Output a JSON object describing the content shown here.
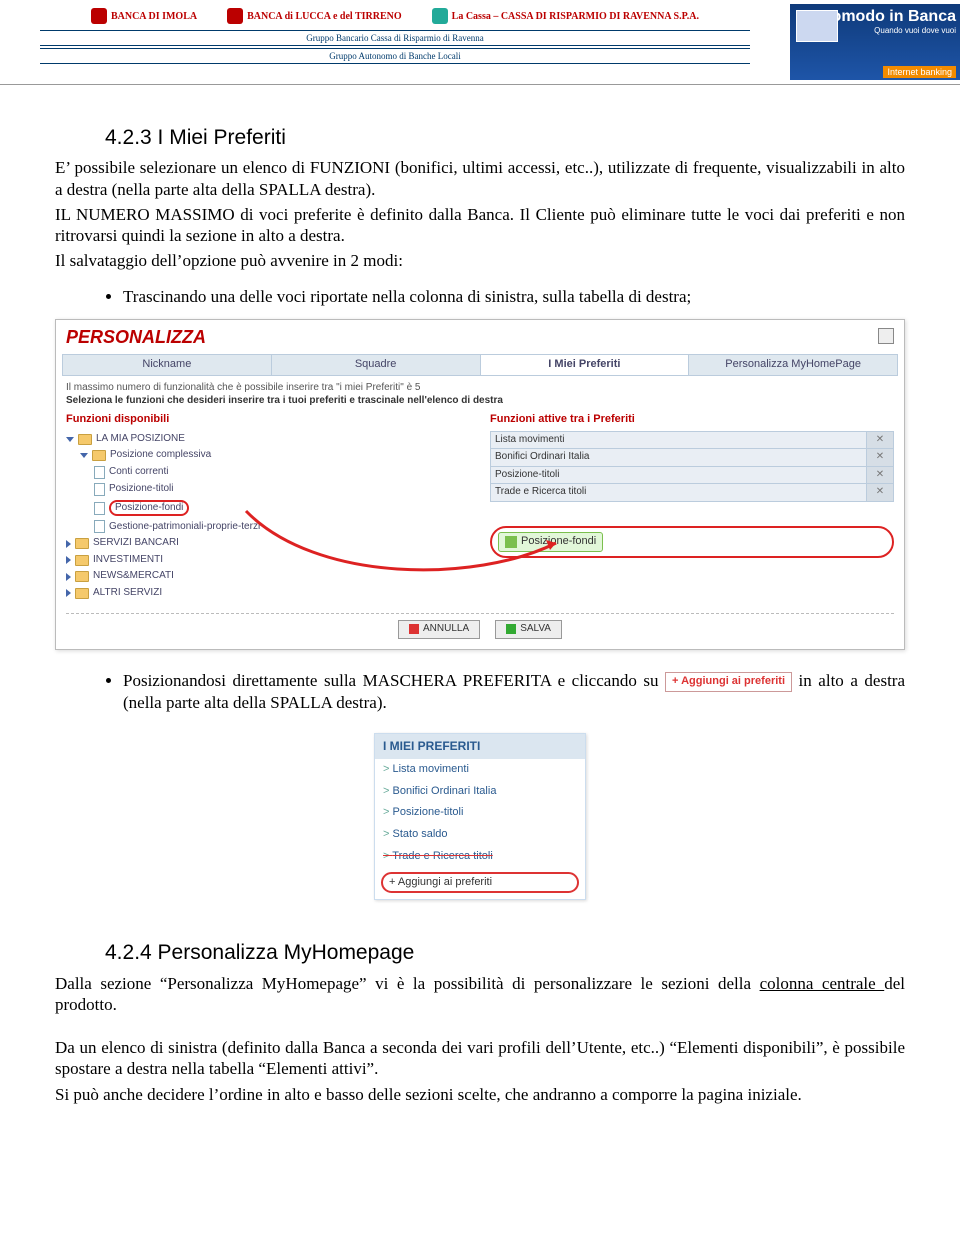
{
  "header": {
    "logos": [
      "BANCA DI IMOLA",
      "BANCA di LUCCA e del TIRRENO",
      "La Cassa – CASSA DI RISPARMIO DI RAVENNA S.P.A."
    ],
    "tagline1": "Gruppo Bancario Cassa di Risparmio di Ravenna",
    "tagline2": "Gruppo Autonomo di Banche Locali",
    "banner": {
      "line1": "Comodo in Banca",
      "line2": "Quando vuoi dove vuoi",
      "line3": "Internet banking"
    }
  },
  "sec1": {
    "heading": "4.2.3 I Miei Preferiti",
    "p1": "E’ possibile selezionare un elenco di FUNZIONI (bonifici, ultimi accessi, etc..), utilizzate di frequente, visualizzabili in alto a destra (nella parte alta della SPALLA destra).",
    "p2": "IL NUMERO MASSIMO di voci preferite è definito dalla Banca. Il Cliente può eliminare tutte le voci dai preferiti e non ritrovarsi quindi la sezione in alto a destra.",
    "p3": "Il salvataggio dell’opzione può avvenire in 2 modi:",
    "bullet1": "Trascinando una delle voci riportate nella colonna di sinistra, sulla tabella di destra;",
    "bullet2a": "Posizionandosi direttamente sulla MASCHERA PREFERITA e cliccando su",
    "ribbon": "+ Aggiungi ai preferiti",
    "bullet2b": " in alto a destra (nella parte alta della SPALLA destra)."
  },
  "shot1": {
    "title": "PERSONALIZZA",
    "tabs": [
      "Nickname",
      "Squadre",
      "I Miei Preferiti",
      "Personalizza MyHomePage"
    ],
    "info1": "Il massimo numero di funzionalità che è possibile inserire tra \"i miei Preferiti\" è   5",
    "info2": "Seleziona le funzioni che desideri inserire tra i tuoi preferiti e trascinale nell'elenco di destra",
    "leftHeading": "Funzioni disponibili",
    "rightHeading": "Funzioni attive tra i Preferiti",
    "tree": {
      "n0": "LA MIA POSIZIONE",
      "n1": "Posizione complessiva",
      "n2": "Conti correnti",
      "n3": "Posizione-titoli",
      "n4": "Posizione-fondi",
      "n5": "Gestione-patrimoniali-proprie-terzi",
      "n6": "SERVIZI BANCARI",
      "n7": "INVESTIMENTI",
      "n8": "NEWS&MERCATI",
      "n9": "ALTRI SERVIZI"
    },
    "active": [
      "Lista movimenti",
      "Bonifici Ordinari Italia",
      "Posizione-titoli",
      "Trade e Ricerca titoli"
    ],
    "drop": "Posizione-fondi",
    "btnCancel": "ANNULLA",
    "btnSave": "SALVA"
  },
  "shot2": {
    "title": "I MIEI PREFERITI",
    "items": [
      "Lista movimenti",
      "Bonifici Ordinari Italia",
      "Posizione-titoli",
      "Stato saldo",
      "Trade e Ricerca titoli"
    ],
    "add": "+ Aggiungi ai preferiti"
  },
  "sec2": {
    "heading": "4.2.4 Personalizza MyHomepage",
    "p1a": "Dalla sezione “Personalizza MyHomepage” vi è la possibilità di personalizzare le sezioni della ",
    "p1u": "colonna centrale ",
    "p1b": "del prodotto.",
    "p2": "Da un elenco di sinistra (definito dalla Banca a seconda dei vari profili dell’Utente, etc..) “Elementi disponibili”, è possibile spostare a destra nella tabella “Elementi attivi”.",
    "p3": "Si può anche decidere l’ordine in alto e basso delle sezioni scelte, che andranno a comporre la pagina iniziale."
  }
}
